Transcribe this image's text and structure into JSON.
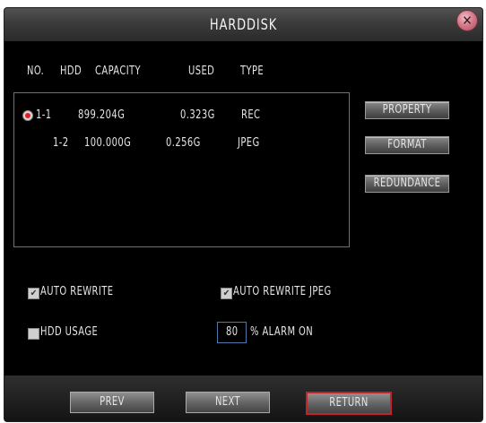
{
  "title": "HARDDISK",
  "columns": [
    "NO.",
    "HDD",
    "CAPACITY",
    "USED",
    "TYPE"
  ],
  "rows": [
    {
      "no": "1-1",
      "capacity": "899.204G",
      "used": "0.323G",
      "type": "REC",
      "selected": true
    },
    {
      "no": "1-2",
      "capacity": "100.000G",
      "used": "0.256G",
      "type": "JPEG",
      "selected": false
    }
  ],
  "side_buttons": {
    "property": "PROPERTY",
    "format": "FORMAT",
    "redundance": "REDUNDANCE"
  },
  "options": {
    "auto_rewrite": {
      "label": "AUTO REWRITE",
      "checked": true
    },
    "auto_rewrite_jpeg": {
      "label": "AUTO REWRITE JPEG",
      "checked": true
    },
    "hdd_usage": {
      "label": "HDD USAGE",
      "checked": false
    },
    "alarm_value": "80",
    "alarm_suffix": "% ALARM ON"
  },
  "footer": {
    "prev": "PREV",
    "next": "NEXT",
    "return": "RETURN"
  },
  "colors": {
    "accent_border": "#4f78a8",
    "active_button_border": "#c0242a",
    "radio_selected": "#e02020"
  }
}
